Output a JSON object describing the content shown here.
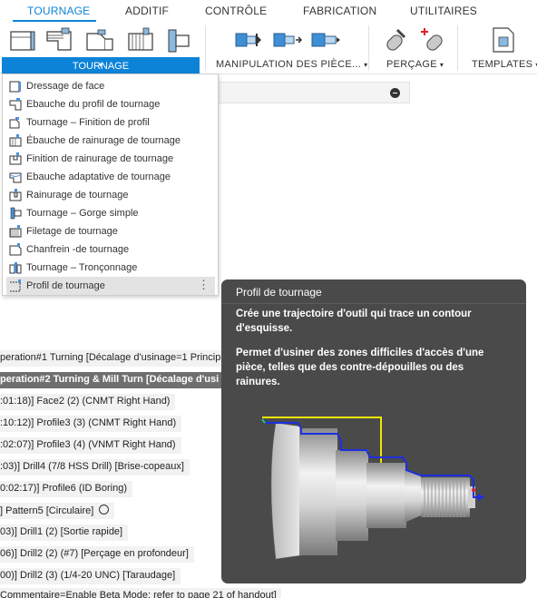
{
  "tabs": [
    {
      "label": "TOURNAGE",
      "active": true
    },
    {
      "label": "ADDITIF"
    },
    {
      "label": "CONTRÔLE"
    },
    {
      "label": "FABRICATION"
    },
    {
      "label": "UTILITAIRES"
    }
  ],
  "ribbon": {
    "groups": {
      "tournage": "TOURNAGE",
      "manipulation": "MANIPULATION DES PIÈCE...",
      "percage": "PERÇAGE",
      "templates": "TEMPLATES"
    }
  },
  "menu": {
    "items": [
      "Dressage de face",
      "Ebauche du profil de tournage",
      "Tournage – Finition de profil",
      "Ébauche de rainurage de tournage",
      "Finition de rainurage de tournage",
      "Ebauche adaptative de tournage",
      "Rainurage de tournage",
      "Tournage – Gorge simple",
      "Filetage de tournage",
      "Chanfrein -de tournage",
      "Tournage – Tronçonnage",
      "Profil de tournage"
    ],
    "more": "⋮"
  },
  "tree": {
    "rows": [
      "peration#1 Turning [Décalage d'usinage=1 Principal",
      "peration#2 Turning & Mill Turn [Décalage d'usi",
      ":01:18)] Face2 (2) (CNMT Right Hand)",
      ":10:12)] Profile3 (3) (CNMT Right Hand)",
      ":02:07)] Profile3 (4) (VNMT Right Hand)",
      ":03)] Drill4 (7/8 HSS Drill) [Brise-copeaux]",
      "0:02:17)] Profile6 (ID Boring)",
      "] Pattern5 [Circulaire]",
      "03)] Drill1 (2) [Sortie rapide]",
      "06)] Drill2 (2) (#7) [Perçage en profondeur]",
      "00)] Drill2 (3) (1/4-20 UNC) [Taraudage]",
      "Commentaire=Enable Beta Mode: refer to page 21 of handout]"
    ]
  },
  "tooltip": {
    "title": "Profil de tournage",
    "p1": "Crée une trajectoire d'outil qui trace un contour d'esquisse.",
    "p2": "Permet d'usiner des zones difficiles d'accès d'une pièce, telles que des contre-dépouilles ou des rainures."
  },
  "colors": {
    "accent": "#0d83d8",
    "tooltip_bg": "#4a4a4a",
    "path_blue": "#1d2fe0",
    "path_yellow": "#f2e600"
  }
}
